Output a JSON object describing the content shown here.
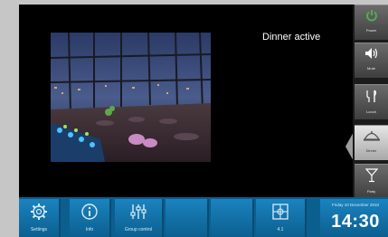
{
  "main": {
    "status": "Dinner active"
  },
  "side_buttons": [
    {
      "icon": "power-icon",
      "label": "Power"
    },
    {
      "icon": "speaker-icon",
      "label": "Mute"
    },
    {
      "icon": "lunch-icon",
      "label": "Lunch"
    },
    {
      "icon": "dinner-cloche-icon",
      "label": "Dinner"
    },
    {
      "icon": "cocktail-icon",
      "label": "Party"
    }
  ],
  "bottom_bar": {
    "settings_label": "Settings",
    "info_label": "Info",
    "group_control_label": "Group control",
    "zone_label": "4.1",
    "date": "Friday 10 December 2010",
    "time": "14:30"
  },
  "colors": {
    "bar_blue": "#0b5f8f",
    "tile_blue": "#1a83bf",
    "power_green": "#4caf50",
    "active_gray": "#d8d8d8"
  }
}
